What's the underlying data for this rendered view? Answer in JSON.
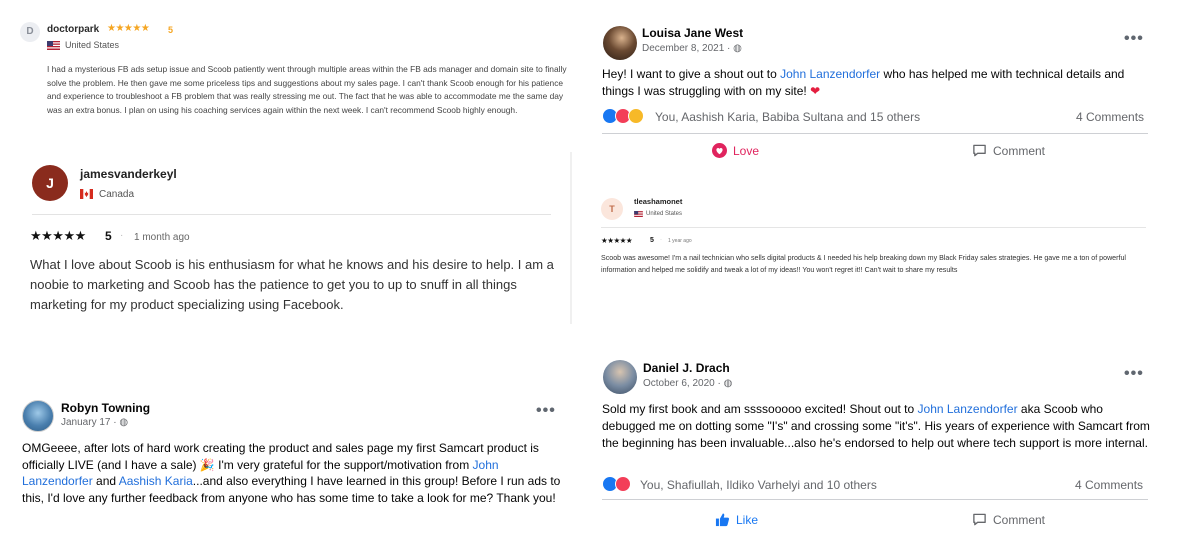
{
  "doctorpark": {
    "avatar_initial": "D",
    "name": "doctorpark",
    "stars": "★★★★★",
    "score": "5",
    "country": "United States",
    "body": "I had a mysterious FB ads setup issue and Scoob patiently went through multiple areas within the FB ads manager and domain site to finally solve the problem. He then gave me some priceless tips and suggestions about my sales page. I can't thank Scoob enough for his patience and experience to troubleshoot a FB problem that was really stressing me out. The fact that he was able to accommodate me the same day was an extra bonus. I plan on using his coaching services again within the next week. I can't recommend Scoob highly enough."
  },
  "james": {
    "avatar_initial": "J",
    "name": "jamesvanderkeyl",
    "country": "Canada",
    "stars": "★★★★★",
    "score": "5",
    "separator": "·",
    "date": "1 month ago",
    "body": "What I love about Scoob is his enthusiasm for what he knows and his desire to help. I am a noobie to marketing and Scoob has the patience to get you to up to snuff in all things marketing for my product specializing using Facebook."
  },
  "robyn": {
    "name": "Robyn Towning",
    "date": "January 17 · ",
    "more": "•••",
    "body_1": "OMGeeee, after lots of hard work creating the product and sales page my first Samcart product is officially LIVE (and I have a sale) 🎉  I'm very grateful for the support/motivation from ",
    "mention_1": "John Lanzendorfer",
    "body_2": " and ",
    "mention_2": "Aashish Karia",
    "body_3": "...and also everything I have learned in this group!  Before I run ads to this, I'd love any further feedback from anyone who has some time to take a look for me? Thank you!"
  },
  "louisa": {
    "name": "Louisa Jane West",
    "date": "December 8, 2021 · ",
    "more": "•••",
    "body_1": "Hey! I want to give a shout out to ",
    "mention": "John Lanzendorfer",
    "body_2": " who has helped me with technical details and things I was struggling with on my site! ",
    "heart": "❤",
    "reactions_text": "You, Aashish Karia, Babiba Sultana and 15 others",
    "comments": "4 Comments",
    "love_label": "Love",
    "comment_label": "Comment"
  },
  "tlea": {
    "avatar_initial": "T",
    "name": "tleashamonet",
    "country": "United States",
    "stars": "★★★★★",
    "score": "5",
    "separator": "·",
    "date": "1 year ago",
    "body": "Scoob was awesome! I'm a nail technician who sells digital products & I needed his help breaking down my Black Friday sales strategies. He gave me a ton of powerful information and helped me solidify and tweak a lot of my ideas!! You won't regret it!! Can't wait to share my results"
  },
  "daniel": {
    "name": "Daniel J. Drach",
    "date": "October 6, 2020 · ",
    "more": "•••",
    "body_1": "Sold my first book and am ssssooooo excited! Shout out to ",
    "mention": "John Lanzendorfer",
    "body_2": " aka Scoob who debugged me on dotting some \"I's\" and crossing some \"it's\". His years of experience with Samcart from the beginning has been invaluable...also he's endorsed to help out where tech support is more internal.",
    "reactions_text": "You, Shafiullah, Ildiko Varhelyi and 10 others",
    "comments": "4 Comments",
    "like_label": "Like",
    "comment_label": "Comment"
  },
  "colors": {
    "facebook_blue": "#1877f2",
    "mention_blue": "#216fdb",
    "love_red": "#e0245e",
    "trustpilot_star": "#f5a623"
  }
}
